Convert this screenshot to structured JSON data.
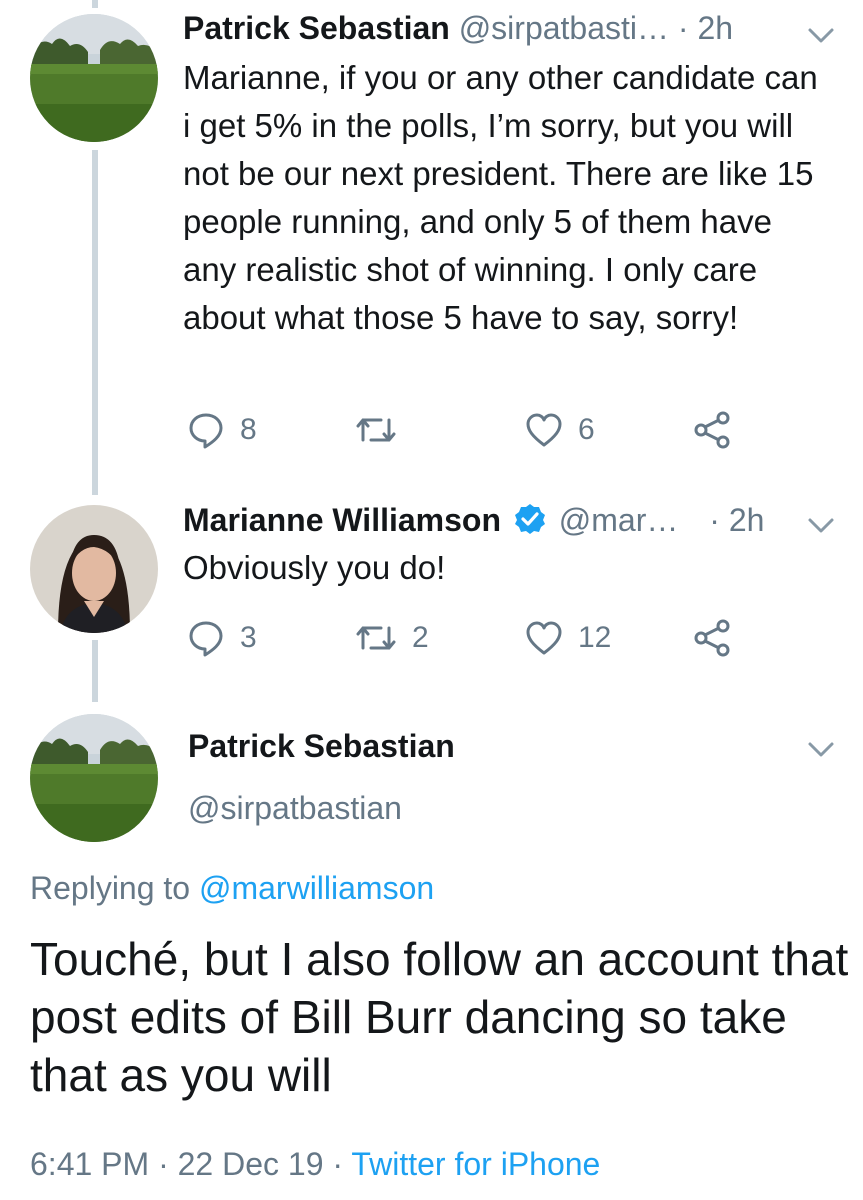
{
  "tweets": [
    {
      "name": "Patrick Sebastian",
      "handle": "@sirpatbasti…",
      "time": "· 2h",
      "text": "Marianne, if you or any other candidate can i get 5% in the polls, I’m sorry, but you will not be our next president. There are like 15 people running, and only 5 of them have any realistic shot of winning. I only care about what those 5 have to say, sorry!",
      "replies": "8",
      "retweets": "",
      "likes": "6"
    },
    {
      "name": "Marianne Williamson",
      "verified": true,
      "handle": "@mar…",
      "time": "· 2h",
      "text": "Obviously you do!",
      "replies": "3",
      "retweets": "2",
      "likes": "12"
    }
  ],
  "focused": {
    "name": "Patrick Sebastian",
    "handle": "@sirpatbastian",
    "replying_prefix": "Replying to",
    "replying_to": "@marwilliamson",
    "text": "Touché, but I also follow an account that post edits of Bill Burr dancing so take that as you will",
    "time": "6:41 PM · 22 Dec 19 ·",
    "source": "Twitter for iPhone"
  },
  "colors": {
    "link": "#1da1f2",
    "secondary": "#657786",
    "thread_line": "#ccd6dd",
    "verified": "#1da1f2"
  },
  "icons": [
    "reply-icon",
    "retweet-icon",
    "like-icon",
    "share-icon",
    "chevron-down-icon",
    "verified-badge-icon"
  ]
}
